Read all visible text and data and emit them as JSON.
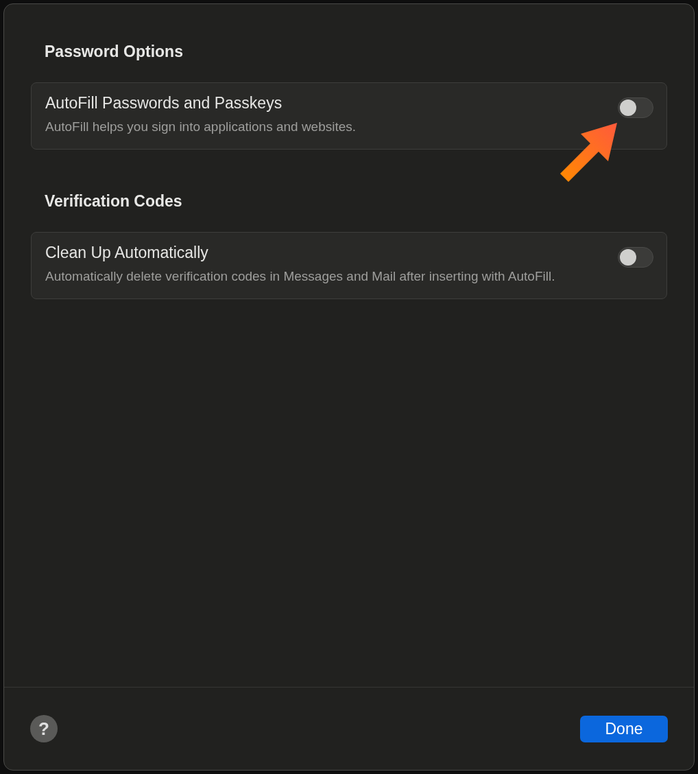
{
  "sections": [
    {
      "title": "Password Options",
      "items": [
        {
          "title": "AutoFill Passwords and Passkeys",
          "description": "AutoFill helps you sign into applications and websites.",
          "on": false,
          "highlighted": true
        }
      ]
    },
    {
      "title": "Verification Codes",
      "items": [
        {
          "title": "Clean Up Automatically",
          "description": "Automatically delete verification codes in Messages and Mail after inserting with AutoFill.",
          "on": false,
          "highlighted": false
        }
      ]
    }
  ],
  "footer": {
    "help": "?",
    "button": "Done"
  }
}
